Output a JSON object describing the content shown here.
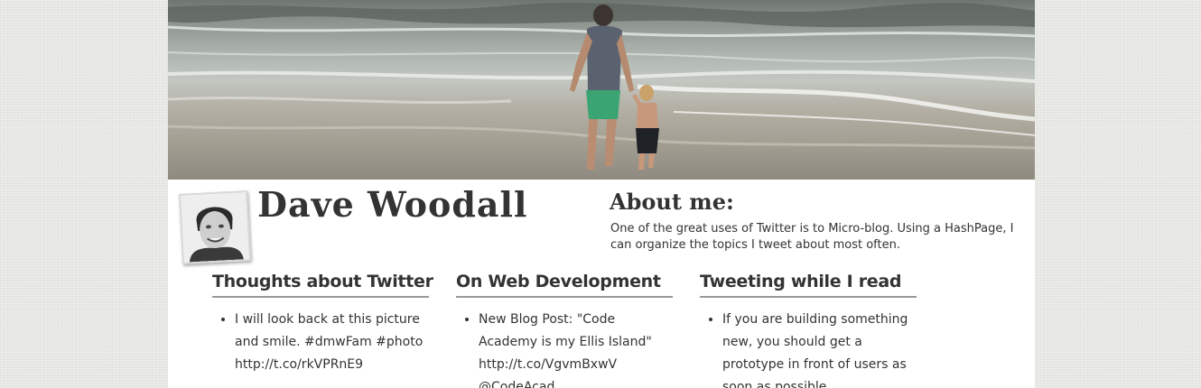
{
  "header": {
    "name": "Dave Woodall",
    "hero_image": "beach-photo-father-and-son-walking-in-surf",
    "avatar": "profile-photo"
  },
  "about": {
    "title": "About me:",
    "text": "One of the great uses of Twitter is to Micro-blog. Using a HashPage, I can organize the topics I tweet about most often."
  },
  "columns": [
    {
      "title": "Thoughts about Twitter",
      "items": [
        "I will look back at this picture and smile. #dmwFam #photo http://t.co/rkVPRnE9"
      ]
    },
    {
      "title": "On Web Development",
      "items": [
        "New Blog Post: \"Code Academy is my Ellis Island\" http://t.co/VgvmBxwV @CodeAcad"
      ]
    },
    {
      "title": "Tweeting while I read",
      "items": [
        "If you are building something new, you should get a prototype in front of users as soon as possible."
      ]
    }
  ],
  "colors": {
    "background": "#e7e7e3",
    "content": "#ffffff",
    "text": "#333333",
    "rule": "#999999"
  }
}
